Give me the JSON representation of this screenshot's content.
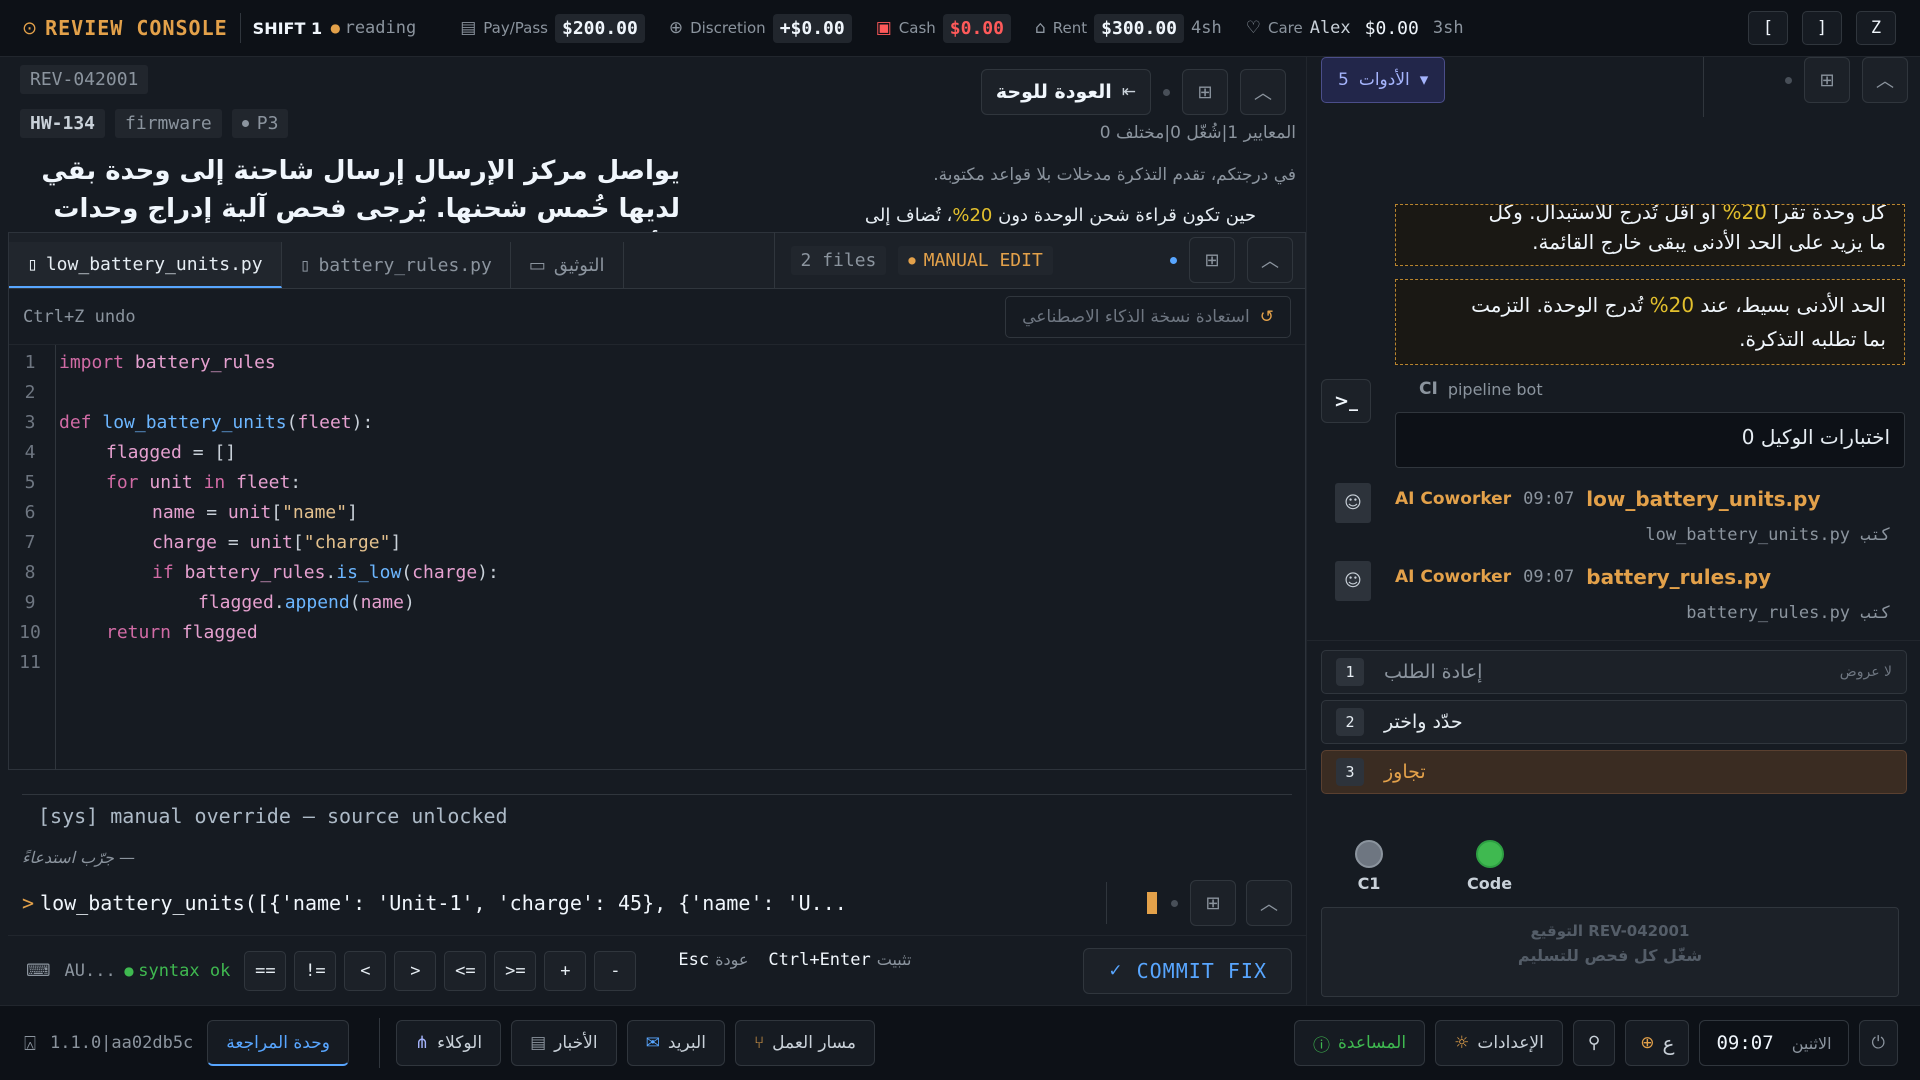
{
  "topbar": {
    "brand": "REVIEW CONSOLE",
    "shift": "SHIFT 1",
    "mode": "reading",
    "paypass_label": "Pay/Pass",
    "paypass_value": "$200.00",
    "discretion_label": "Discretion",
    "discretion_value": "+$0.00",
    "cash_label": "Cash",
    "cash_value": "$0.00",
    "rent_label": "Rent",
    "rent_value": "$300.00",
    "rent_due": "4sh",
    "care_label": "Care",
    "care_name": "Alex",
    "care_value": "$0.00",
    "care_due": "3sh",
    "keys": [
      "[",
      "]",
      "Z"
    ]
  },
  "ticket": {
    "review_id": "REV-042001",
    "hw_id": "HW-134",
    "category": "firmware",
    "priority": "P3",
    "title": "يواصل مركز الإرسال إرسال شاحنة إلى وحدة بقي لديها خُمس شحنها. يُرجى فحص آلية إدراج وحدات الأسطول",
    "back_label": "العودة للوحة",
    "criteria": "المعايير 1|شُغّل 0|مختلف 0",
    "desc1": "في درجتكم، تقدم التذكرة مدخلات بلا قواعد مكتوبة.",
    "desc2_prefix": "حين تكون قراءة شحن الوحدة دون",
    "desc2_pct": "20%",
    "desc2_suffix": "، تُضاف إلى"
  },
  "editor": {
    "tabs": [
      "low_battery_units.py",
      "battery_rules.py",
      "التوثيق"
    ],
    "files_count": "2 files",
    "manual_edit": "MANUAL EDIT",
    "undo_hint": "Ctrl+Z undo",
    "restore_ai": "استعادة نسخة الذكاء الاصطناعي",
    "lines": [
      "1",
      "2",
      "3",
      "4",
      "5",
      "6",
      "7",
      "8",
      "9",
      "10",
      "11"
    ]
  },
  "console": {
    "sys_msg": "[sys] manual override — source unlocked",
    "try_hint": "— جرّب استدعاءً",
    "prompt": ">",
    "input": "low_battery_units([{'name': 'Unit-1', 'charge': 45}, {'name': 'U..."
  },
  "bottomtool": {
    "au": "AU...",
    "syntax": "syntax ok",
    "ops": [
      "==",
      "!=",
      "<",
      ">",
      "<=",
      ">=",
      "+",
      "-"
    ],
    "esc_key": "Esc",
    "esc_label": "عودة",
    "pin_key": "Ctrl+Enter",
    "pin_label": "تثبيت",
    "commit": "COMMIT FIX"
  },
  "rpanel": {
    "tools_count": "5",
    "tools_label": "الأدوات",
    "note1_line1_pre": "كل وحدة تقرأ",
    "note1_line1_pct": "20%",
    "note1_line1_post": "أو أقل تُدرج للاستبدال. وكل",
    "note1_line2": "ما يزيد على الحد الأدنى يبقى خارج القائمة.",
    "note2_pre": "الحد الأدنى بسيط، عند",
    "note2_pct": "20%",
    "note2_post": "تُدرج الوحدة. التزمت",
    "note2_line2": "بما تطلبه التذكرة.",
    "ci_label": "CI",
    "ci_name": "pipeline bot",
    "agent_tests": "اختبارات الوكيل 0",
    "msgs": [
      {
        "author": "AI Coworker",
        "time": "09:07",
        "file": "low_battery_units.py",
        "sub": "كتب low_battery_units.py"
      },
      {
        "author": "AI Coworker",
        "time": "09:07",
        "file": "battery_rules.py",
        "sub": "كتب battery_rules.py"
      }
    ],
    "options": [
      {
        "num": "1",
        "label": "إعادة الطلب",
        "note": "لا عروض"
      },
      {
        "num": "2",
        "label": "حدّد واختر",
        "note": ""
      },
      {
        "num": "3",
        "label": "تجاوز",
        "note": ""
      }
    ],
    "status_c1": "C1",
    "status_code": "Code",
    "sign_title": "التوقيع REV-042001",
    "sign_sub": "شغّل كل فحص للتسليم"
  },
  "statusbar": {
    "version": "1.1.0|aa02db5c",
    "review_unit": "وحدة المراجعة",
    "agents": "الوكلاء",
    "news": "الأخبار",
    "mail": "البريد",
    "workflow": "مسار العمل",
    "help": "المساعدة",
    "settings": "الإعدادات",
    "lang": "ع",
    "clock": "09:07",
    "day": "الاثنين"
  },
  "colors": {
    "accent_orange": "#e3a14a",
    "accent_blue": "#58a6ff",
    "danger": "#ff5a5a",
    "ok_green": "#3fb950"
  }
}
